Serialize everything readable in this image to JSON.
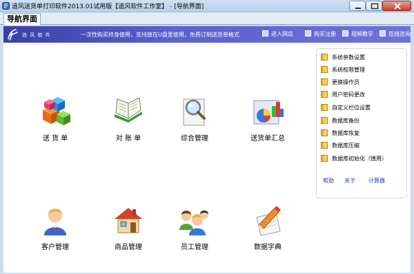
{
  "window": {
    "title": "追风送货单打印软件2013.01试用版【追风软件工作室】 - [导航界面]",
    "tab": "导航界面"
  },
  "banner": {
    "brand": "追 风 软 件",
    "slogan": "一次性购买终身使用，支持放在U盘里使用，免费订制送货单格式",
    "nav": [
      "进入网店",
      "购买注册",
      "视频教学",
      "在线咨询"
    ]
  },
  "tiles": [
    {
      "label": "送 货 单",
      "icon": "cubes-icon"
    },
    {
      "label": "对 账 单",
      "icon": "open-book-icon"
    },
    {
      "label": "综合管理",
      "icon": "magnifier-icon"
    },
    {
      "label": "送货单汇总",
      "icon": "chart-icon"
    },
    {
      "label": "客户管理",
      "icon": "person-icon"
    },
    {
      "label": "商品管理",
      "icon": "house-icon"
    },
    {
      "label": "员工管理",
      "icon": "people-icon"
    },
    {
      "label": "数据字典",
      "icon": "pencil-paper-icon"
    }
  ],
  "menu": {
    "items": [
      "系统参数设置",
      "系统权限管理",
      "更换操作员",
      "用户密码更改",
      "自定义栏位设置",
      "数据库备份",
      "数据库恢复",
      "数据库压缩",
      "数据库初始化（慎用）"
    ],
    "links": [
      "帮助",
      "关于",
      "计算器"
    ]
  },
  "colors": {
    "banner": "#4a4fc0",
    "link": "#1a3fb0",
    "titlebar": "#c4d7ee"
  }
}
